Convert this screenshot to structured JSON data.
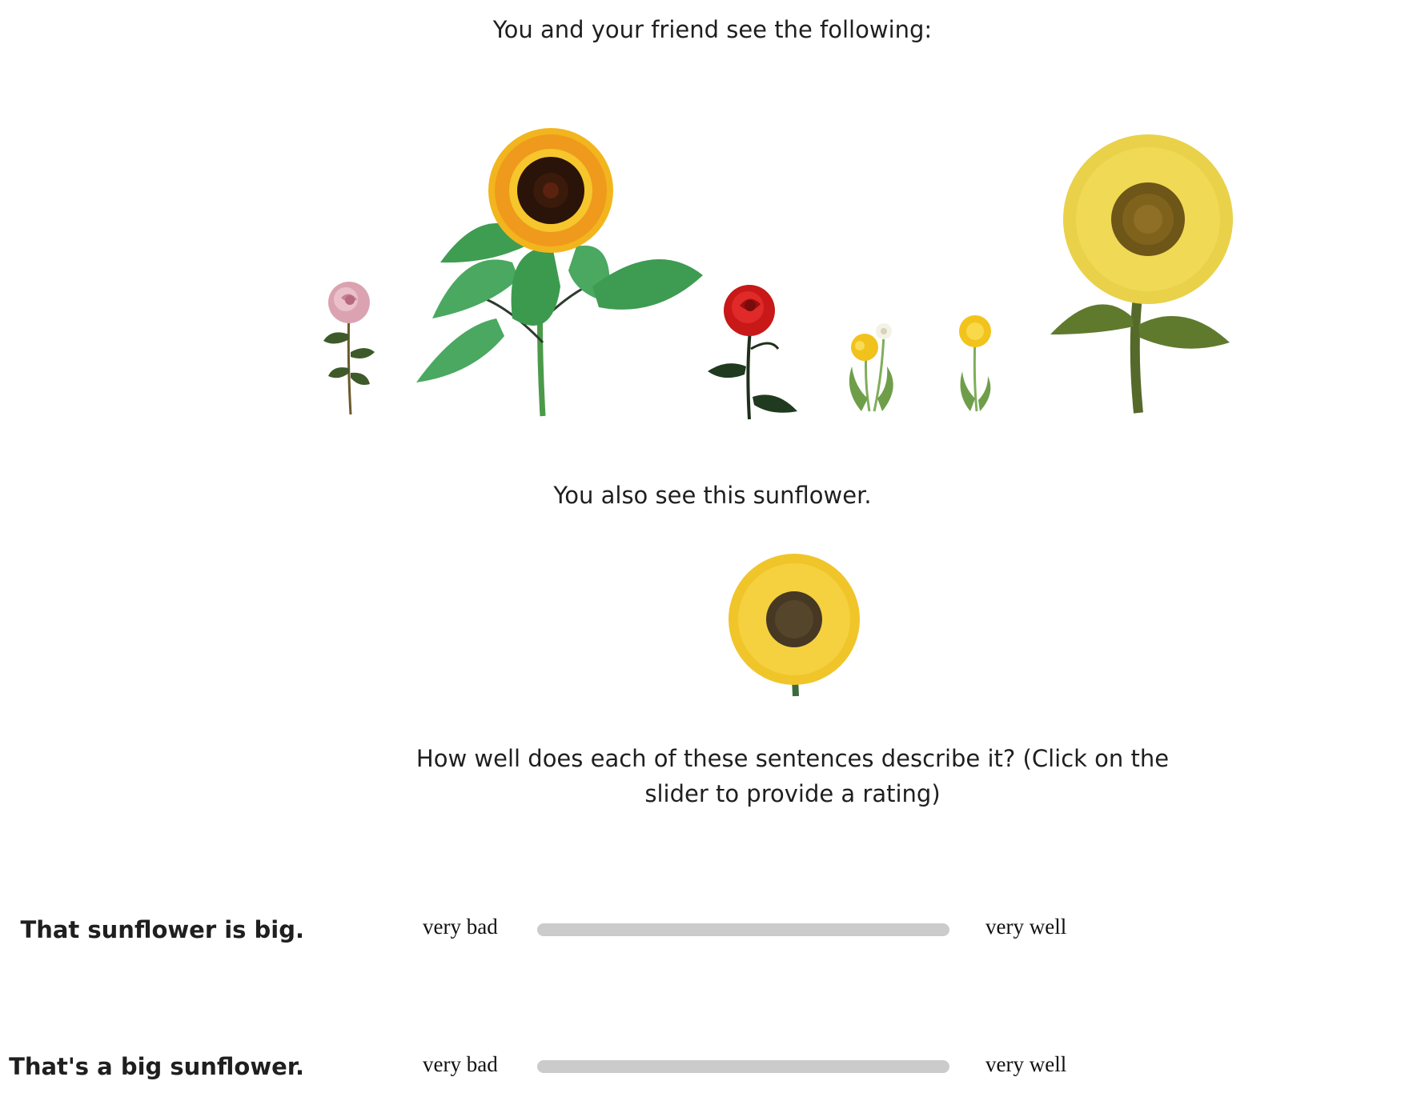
{
  "intro_text": "You and your friend see the following:",
  "context_flowers": [
    {
      "icon": "pink-rose-icon"
    },
    {
      "icon": "orange-sunflower-icon"
    },
    {
      "icon": "red-rose-icon"
    },
    {
      "icon": "dandelion-cluster-icon"
    },
    {
      "icon": "dandelion-icon"
    },
    {
      "icon": "yellow-sunflower-icon"
    }
  ],
  "target_text": "You also see this sunflower.",
  "target_flower": {
    "icon": "small-sunflower-icon"
  },
  "question": "How well does each of these sentences describe it? (Click on the slider to provide a rating)",
  "ratings": [
    {
      "sentence": "That sunflower is big.",
      "low_label": "very bad",
      "high_label": "very well"
    },
    {
      "sentence": "That's a big sunflower.",
      "low_label": "very bad",
      "high_label": "very well"
    }
  ],
  "colors": {
    "slider_track": "#cbcbcb",
    "text": "#1f1f1f"
  }
}
